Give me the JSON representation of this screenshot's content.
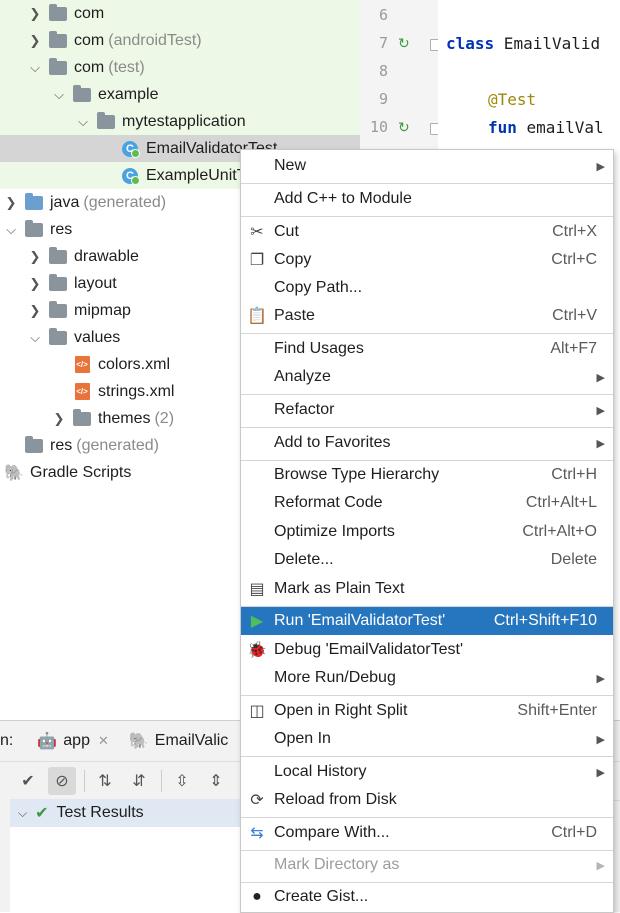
{
  "project_tree": {
    "items": [
      {
        "label": "com",
        "suffix": ""
      },
      {
        "label": "com",
        "suffix": "(androidTest)"
      },
      {
        "label": "com",
        "suffix": "(test)"
      },
      {
        "label": "example",
        "suffix": ""
      },
      {
        "label": "mytestapplication",
        "suffix": ""
      },
      {
        "label": "EmailValidatorTest",
        "suffix": ""
      },
      {
        "label": "ExampleUnitTest",
        "suffix": ""
      },
      {
        "label": "java",
        "suffix": "(generated)"
      },
      {
        "label": "res",
        "suffix": ""
      },
      {
        "label": "drawable",
        "suffix": ""
      },
      {
        "label": "layout",
        "suffix": ""
      },
      {
        "label": "mipmap",
        "suffix": ""
      },
      {
        "label": "values",
        "suffix": ""
      },
      {
        "label": "colors.xml",
        "suffix": ""
      },
      {
        "label": "strings.xml",
        "suffix": ""
      },
      {
        "label": "themes",
        "suffix": "(2)"
      },
      {
        "label": "res",
        "suffix": "(generated)"
      },
      {
        "label": "Gradle Scripts",
        "suffix": ""
      }
    ]
  },
  "editor": {
    "lines": [
      {
        "num": "6",
        "text": ""
      },
      {
        "num": "7",
        "keyword": "class",
        "text": " EmailValid"
      },
      {
        "num": "8",
        "text": ""
      },
      {
        "num": "9",
        "annotation": "@Test"
      },
      {
        "num": "10",
        "keyword": "fun",
        "text": " emailVal"
      }
    ]
  },
  "bottom_panel": {
    "run_label": "n:",
    "tabs": [
      {
        "label": "app"
      },
      {
        "label": "EmailValic"
      }
    ],
    "results_label": "Test Results"
  },
  "context_menu": {
    "items": [
      {
        "label": "New",
        "shortcut": "",
        "submenu": true
      },
      {
        "label": "Add C++ to Module",
        "shortcut": ""
      },
      {
        "label": "Cut",
        "shortcut": "Ctrl+X",
        "icon": "scissors-icon"
      },
      {
        "label": "Copy",
        "shortcut": "Ctrl+C",
        "icon": "copy-icon"
      },
      {
        "label": "Copy Path...",
        "shortcut": ""
      },
      {
        "label": "Paste",
        "shortcut": "Ctrl+V",
        "icon": "clipboard-icon"
      },
      {
        "label": "Find Usages",
        "shortcut": "Alt+F7"
      },
      {
        "label": "Analyze",
        "shortcut": "",
        "submenu": true
      },
      {
        "label": "Refactor",
        "shortcut": "",
        "submenu": true
      },
      {
        "label": "Add to Favorites",
        "shortcut": "",
        "submenu": true
      },
      {
        "label": "Browse Type Hierarchy",
        "shortcut": "Ctrl+H"
      },
      {
        "label": "Reformat Code",
        "shortcut": "Ctrl+Alt+L"
      },
      {
        "label": "Optimize Imports",
        "shortcut": "Ctrl+Alt+O"
      },
      {
        "label": "Delete...",
        "shortcut": "Delete"
      },
      {
        "label": "Mark as Plain Text",
        "shortcut": "",
        "icon": "plain-text-icon"
      },
      {
        "label": "Run 'EmailValidatorTest'",
        "shortcut": "Ctrl+Shift+F10",
        "icon": "run-icon",
        "highlighted": true
      },
      {
        "label": "Debug 'EmailValidatorTest'",
        "shortcut": "",
        "icon": "debug-icon"
      },
      {
        "label": "More Run/Debug",
        "shortcut": "",
        "submenu": true
      },
      {
        "label": "Open in Right Split",
        "shortcut": "Shift+Enter",
        "icon": "split-icon"
      },
      {
        "label": "Open In",
        "shortcut": "",
        "submenu": true
      },
      {
        "label": "Local History",
        "shortcut": "",
        "submenu": true
      },
      {
        "label": "Reload from Disk",
        "shortcut": "",
        "icon": "reload-icon"
      },
      {
        "label": "Compare With...",
        "shortcut": "Ctrl+D",
        "icon": "compare-icon"
      },
      {
        "label": "Mark Directory as",
        "shortcut": "",
        "submenu": true,
        "disabled": true
      },
      {
        "label": "Create Gist...",
        "shortcut": "",
        "icon": "github-icon"
      }
    ]
  },
  "colors": {
    "menu_highlight": "#2675bf",
    "test_source_bg": "#eef8e6",
    "run_green": "#3d9a40"
  }
}
